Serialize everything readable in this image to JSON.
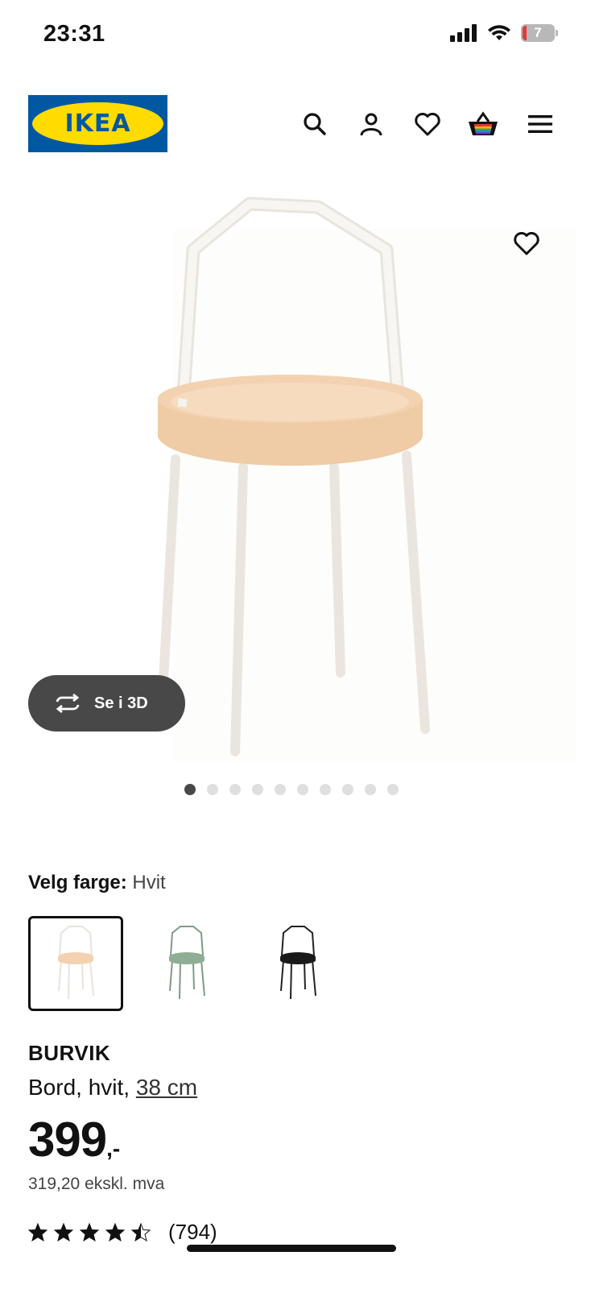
{
  "status_bar": {
    "time": "23:31",
    "battery_level": "7"
  },
  "header": {
    "logo_text": "IKEA",
    "brand_colors": {
      "blue": "#0058a3",
      "yellow": "#ffdb00"
    },
    "icons": [
      "search-icon",
      "account-icon",
      "heart-icon",
      "basket-icon",
      "menu-icon"
    ]
  },
  "gallery": {
    "view_3d_label": "Se i 3D",
    "total_images": 10,
    "active_image_index": 0
  },
  "color_picker": {
    "label": "Velg farge:",
    "selected_value": "Hvit",
    "options": [
      {
        "name": "Hvit",
        "top_color": "#f2d2b0",
        "frame_color": "#e8e4dc",
        "selected": true
      },
      {
        "name": "Grønn",
        "top_color": "#8fae95",
        "frame_color": "#7f9a86",
        "selected": false
      },
      {
        "name": "Svart",
        "top_color": "#1a1a1a",
        "frame_color": "#222222",
        "selected": false
      }
    ]
  },
  "product": {
    "name": "BURVIK",
    "description": "Bord, hvit, ",
    "size_link": "38 cm",
    "price_main": "399",
    "price_suffix": ",-",
    "price_ex_vat": "319,20 ekskl. mva",
    "rating_value": 4.5,
    "rating_count": "(794)"
  }
}
